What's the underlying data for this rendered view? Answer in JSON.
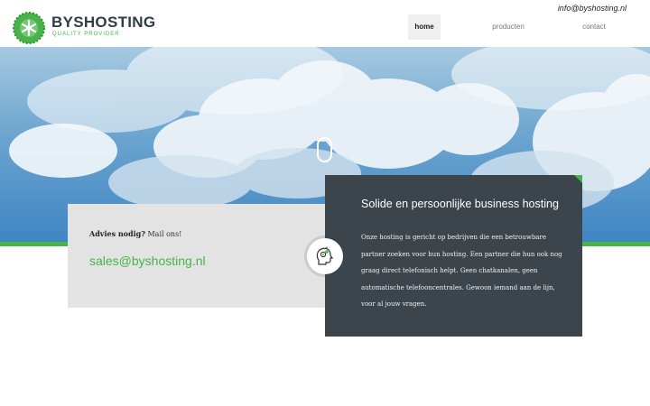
{
  "header": {
    "brand": "BYSHOSTING",
    "tagline": "QUALITY PROVIDER",
    "email": "info@byshosting.nl",
    "nav": [
      {
        "label": "home",
        "active": true
      },
      {
        "label": "producten",
        "active": false
      },
      {
        "label": "contact",
        "active": false
      }
    ]
  },
  "hero": {
    "scroll_icon": "mouse-scroll-icon"
  },
  "advice": {
    "label_bold": "Advies nodig?",
    "label_rest": " Mail ons!",
    "email": "sales@byshosting.nl"
  },
  "info": {
    "title": "Solide en persoonlijke business hosting",
    "body": "Onze hosting is gericht op bedrijven die een betrouwbare partner zoeken voor hun hosting. Een partner die hun ook nog graag direct telefonisch helpt. Geen chatkanalen, geen automatische telefooncentrales. Gewoon iemand aan de lijn, voor al jouw vragen.",
    "icon": "head-gears-icon"
  },
  "colors": {
    "accent": "#47b348",
    "dark_card": "#3c454c",
    "grey_box": "#e3e3e3"
  }
}
